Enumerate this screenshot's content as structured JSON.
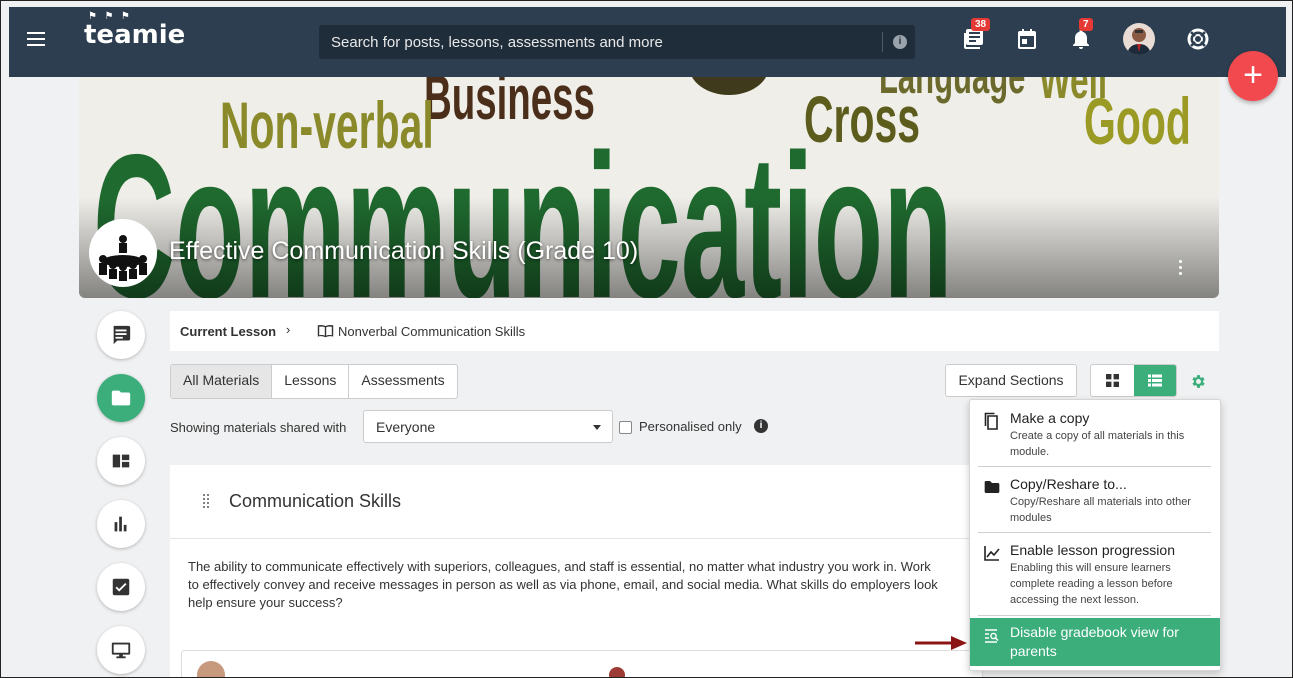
{
  "topbar": {
    "logo_text": "teamie",
    "search_placeholder": "Search for posts, lessons, assessments and more",
    "badges": {
      "posts": "38",
      "notifications": "7"
    },
    "fab_label": "+"
  },
  "banner": {
    "course_title": "Effective Communication Skills (Grade 10)",
    "words": {
      "main": "Communication",
      "nonverbal": "Non-verbal",
      "business": "Business",
      "cross": "Cross",
      "good": "Good",
      "language": "Language",
      "well": "Well"
    }
  },
  "breadcrumb": {
    "current_label": "Current Lesson",
    "lesson": "Nonverbal Communication Skills"
  },
  "tabs": [
    "All Materials",
    "Lessons",
    "Assessments"
  ],
  "toolbar": {
    "expand_label": "Expand Sections"
  },
  "filter": {
    "label": "Showing materials shared with",
    "selected": "Everyone",
    "personalised_label": "Personalised only"
  },
  "section": {
    "title": "Communication Skills",
    "description": "The ability to communicate effectively with superiors, colleagues, and staff is essential, no matter what industry you work in. Work\nto effectively convey and receive messages in person as well as via phone, email, and social media. What skills do employers look\nhelp ensure your success?"
  },
  "menu": {
    "items": [
      {
        "title": "Make a copy",
        "desc": "Create a copy of all materials in this module."
      },
      {
        "title": "Copy/Reshare to...",
        "desc": "Copy/Reshare all materials into other modules"
      },
      {
        "title": "Enable lesson progression",
        "desc": "Enabling this will ensure learners complete reading a lesson before accessing the next lesson."
      },
      {
        "title": "Disable gradebook view for parents",
        "desc": ""
      }
    ]
  },
  "colors": {
    "topbar": "#2c3e50",
    "accent_green": "#3cae7c",
    "fab_red": "#f2494f",
    "badge_red": "#e53935",
    "arrow": "#8b1414"
  }
}
